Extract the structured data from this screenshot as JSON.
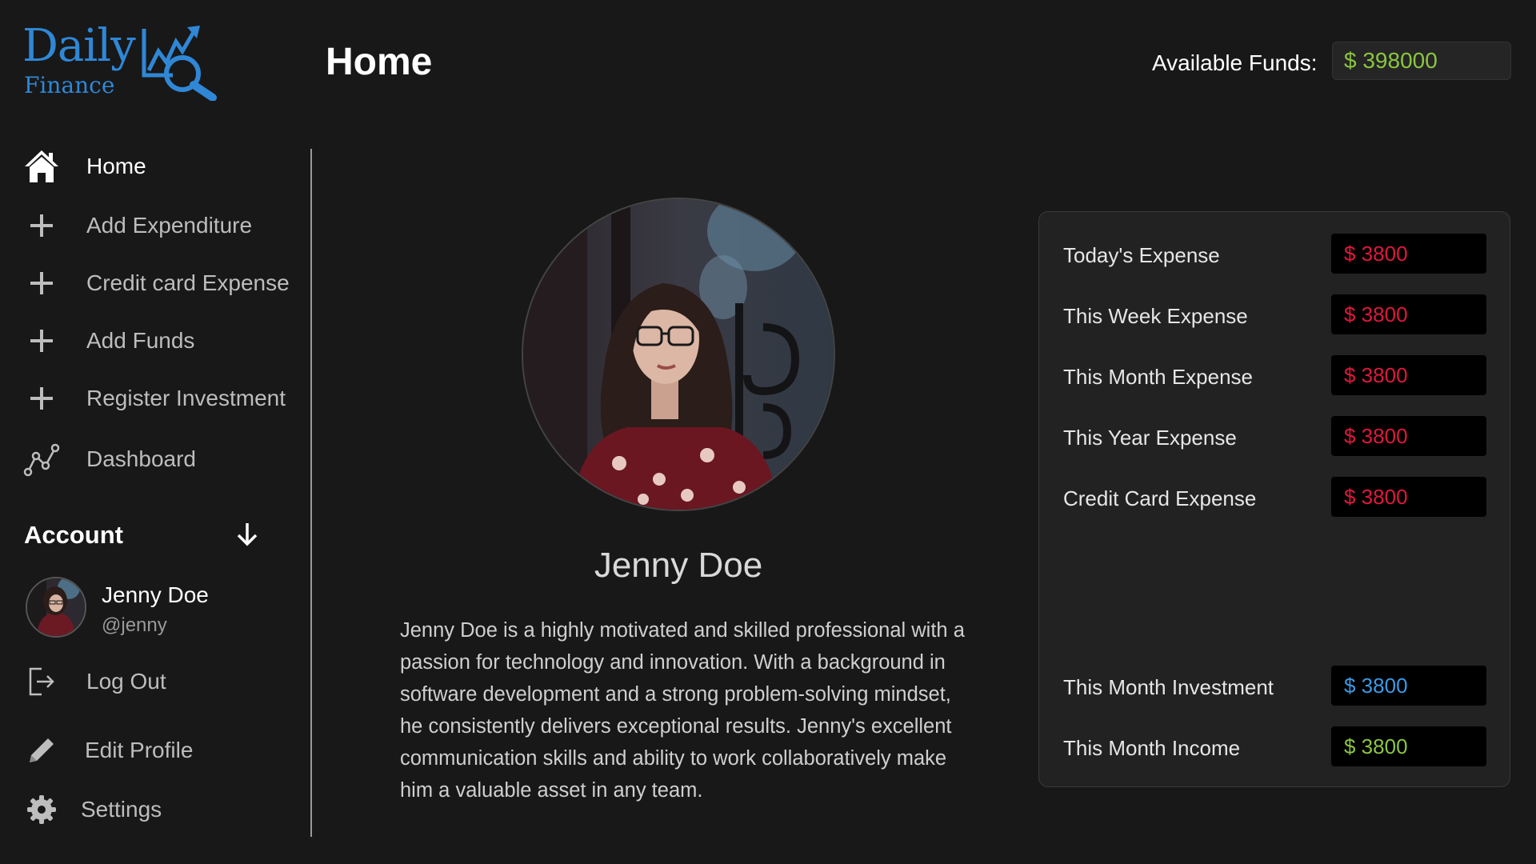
{
  "colors": {
    "background": "#181818",
    "brand": "#2f87d6",
    "expense": "#e0173c",
    "investment": "#3b9ae6",
    "income": "#8bc540",
    "funds": "#8bc540"
  },
  "logo": {
    "line1": "Daily",
    "line2": "Finance",
    "icon": "chart-magnifier-icon"
  },
  "header": {
    "title": "Home",
    "funds_label": "Available Funds:",
    "funds_value": "$ 398000"
  },
  "sidebar": {
    "items": [
      {
        "label": "Home",
        "icon": "home-icon",
        "active": true
      },
      {
        "label": "Add Expenditure",
        "icon": "plus-icon"
      },
      {
        "label": "Credit card Expense",
        "icon": "plus-icon"
      },
      {
        "label": "Add Funds",
        "icon": "plus-icon"
      },
      {
        "label": "Register Investment",
        "icon": "plus-icon"
      },
      {
        "label": "Dashboard",
        "icon": "line-chart-icon"
      }
    ],
    "account_title": "Account",
    "account_toggle_icon": "arrow-down-icon",
    "user": {
      "name": "Jenny Doe",
      "handle": "@jenny"
    },
    "account_items": [
      {
        "label": "Log Out",
        "icon": "logout-icon"
      },
      {
        "label": "Edit Profile",
        "icon": "pencil-icon"
      },
      {
        "label": "Settings",
        "icon": "gear-icon"
      }
    ]
  },
  "profile": {
    "name": "Jenny Doe",
    "bio": "Jenny Doe is a highly motivated and skilled professional with a passion for technology and innovation. With a background in software development and a strong problem-solving mindset, he consistently delivers exceptional results. Jenny's excellent communication skills and ability to work collaboratively make him a valuable asset in any team."
  },
  "stats": {
    "expenses": [
      {
        "label": "Today's Expense",
        "value": "$ 3800"
      },
      {
        "label": "This Week Expense",
        "value": "$ 3800"
      },
      {
        "label": "This Month Expense",
        "value": "$ 3800"
      },
      {
        "label": "This Year Expense",
        "value": "$ 3800"
      },
      {
        "label": "Credit Card Expense",
        "value": "$ 3800"
      }
    ],
    "investment": {
      "label": "This Month Investment",
      "value": "$ 3800"
    },
    "income": {
      "label": "This Month Income",
      "value": "$ 3800"
    }
  }
}
